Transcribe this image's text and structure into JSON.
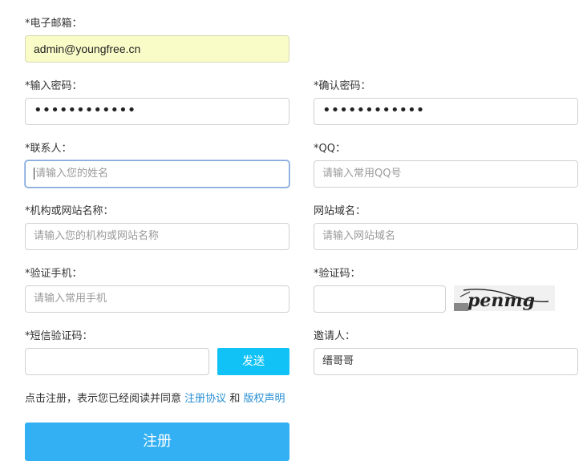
{
  "form": {
    "email": {
      "label": "*电子邮箱：",
      "value": "admin@youngfree.cn"
    },
    "password": {
      "label": "*输入密码：",
      "value": "••••••••••••"
    },
    "confirm_password": {
      "label": "*确认密码：",
      "value": "••••••••••••"
    },
    "contact": {
      "label": "*联系人：",
      "placeholder": "请输入您的姓名"
    },
    "qq": {
      "label": "*QQ：",
      "placeholder": "请输入常用QQ号"
    },
    "org_name": {
      "label": "*机构或网站名称：",
      "placeholder": "请输入您的机构或网站名称"
    },
    "domain": {
      "label": "网站域名：",
      "placeholder": "请输入网站域名"
    },
    "phone": {
      "label": "*验证手机：",
      "placeholder": "请输入常用手机"
    },
    "captcha": {
      "label": "*验证码：",
      "value": "",
      "image_text": "penmg"
    },
    "sms_code": {
      "label": "*短信验证码：",
      "value": "",
      "send_label": "发送"
    },
    "inviter": {
      "label": "邀请人：",
      "value": "缙哥哥"
    }
  },
  "agreement": {
    "prefix": "点击注册，表示您已经阅读并同意",
    "terms_link": "注册协议",
    "conjunction": "和",
    "copyright_link": "版权声明"
  },
  "submit": {
    "label": "注册"
  },
  "colors": {
    "send_button": "#10c2f6",
    "register_button": "#32b0f3",
    "link": "#2a8fd4",
    "autofill": "#fafcc8",
    "focus_border": "#7fa6dc"
  }
}
